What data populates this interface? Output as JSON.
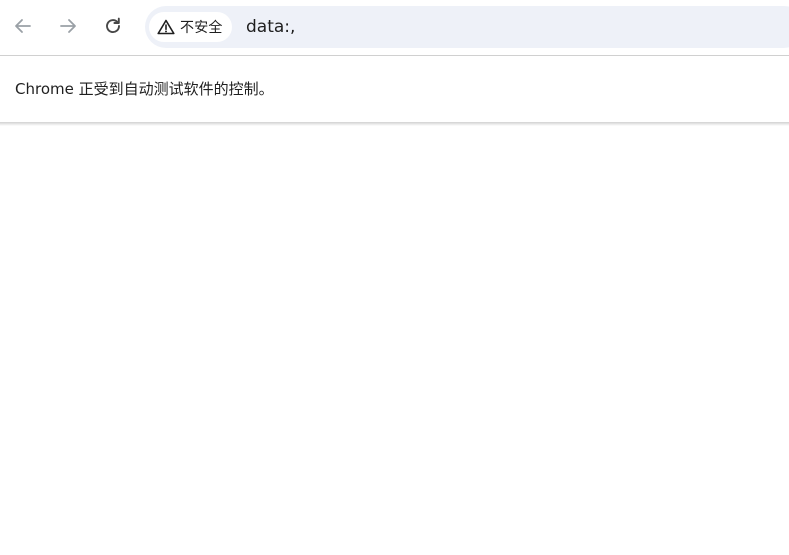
{
  "toolbar": {
    "back": {
      "icon": "arrow-left-icon",
      "enabled": false
    },
    "forward": {
      "icon": "arrow-right-icon",
      "enabled": false
    },
    "reload": {
      "icon": "reload-icon"
    }
  },
  "omnibox": {
    "security_chip": {
      "icon": "warning-triangle-icon",
      "label": "不安全"
    },
    "url": "data:,"
  },
  "infobar": {
    "message": "Chrome 正受到自动测试软件的控制。"
  },
  "colors": {
    "omnibox_bg": "#eef1f8",
    "disabled_icon": "#9aa0a6",
    "icon": "#474747",
    "text": "#1f1f1f"
  }
}
